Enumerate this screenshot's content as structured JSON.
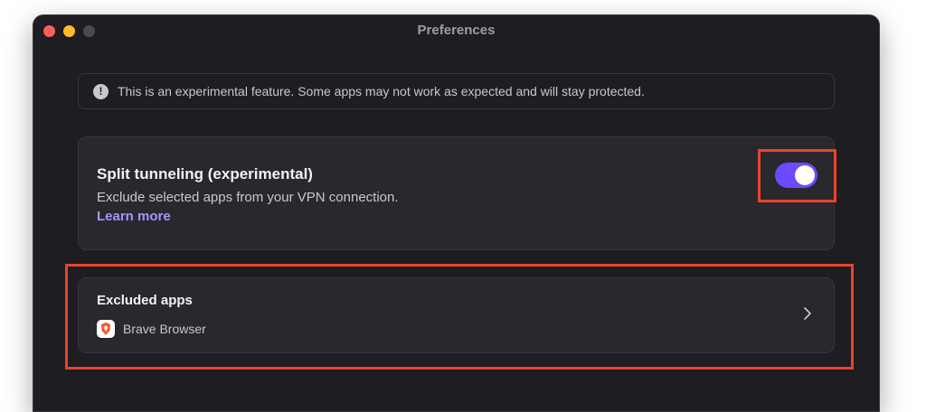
{
  "window": {
    "title": "Preferences"
  },
  "banner": {
    "icon": "exclamation-circle-icon",
    "text": "This is an experimental feature. Some apps may not work as expected and will stay protected."
  },
  "split_tunneling": {
    "title": "Split tunneling (experimental)",
    "description": "Exclude selected apps from your VPN connection.",
    "learn_more": "Learn more",
    "enabled": true,
    "toggle_color": "#6d4aff"
  },
  "excluded_apps": {
    "title": "Excluded apps",
    "apps": [
      {
        "name": "Brave Browser",
        "icon": "brave-browser-icon"
      }
    ],
    "chevron_icon": "chevron-right-icon"
  },
  "colors": {
    "background": "#1e1d21",
    "card": "#29282d",
    "accent": "#6d4aff",
    "link": "#a395ff",
    "highlight": "#e8442b"
  }
}
